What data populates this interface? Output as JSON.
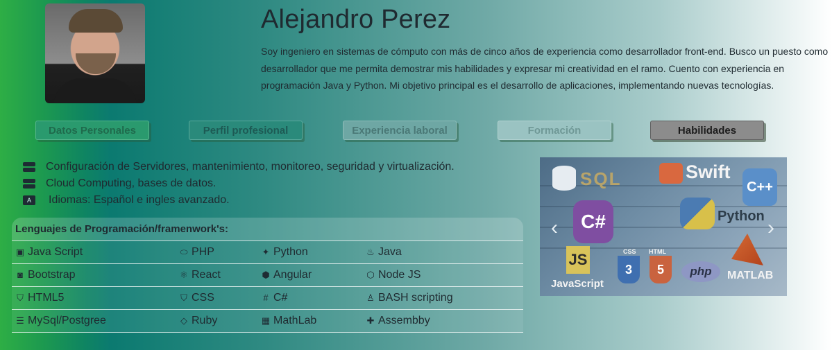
{
  "profile": {
    "name": "Alejandro Perez",
    "bio": "Soy ingeniero en sistemas de cómputo con más de cinco años de experiencia como desarrollador front-end. Busco un puesto como desarrollador que me permita demostrar mis habilidades y expresar mi creatividad en el ramo. Cuento con experiencia en programación Java y Python. Mi objetivo principal es el desarrollo de aplicaciones, implementando nuevas tecnologías."
  },
  "tabs": [
    {
      "label": "Datos Personales"
    },
    {
      "label": "Perfil profesional"
    },
    {
      "label": "Experiencia laboral"
    },
    {
      "label": "Formación"
    },
    {
      "label": "Habilidades",
      "active": true
    }
  ],
  "skills": [
    {
      "icon": "server-icon",
      "text": "Configuración de Servidores, mantenimiento, monitoreo, seguridad y virtualización."
    },
    {
      "icon": "server-icon",
      "text": "Cloud Computing, bases de datos."
    },
    {
      "icon": "language-icon",
      "text": "Idiomas: Español e ingles avanzado."
    }
  ],
  "languages_table": {
    "header": "Lenguajes de Programación/framenwork's:",
    "rows": [
      [
        {
          "icon": "js-icon",
          "label": "Java Script"
        },
        {
          "icon": "php-icon",
          "label": "PHP"
        },
        {
          "icon": "python-icon",
          "label": "Python"
        },
        {
          "icon": "java-icon",
          "label": "Java"
        }
      ],
      [
        {
          "icon": "bootstrap-icon",
          "label": "Bootstrap"
        },
        {
          "icon": "react-icon",
          "label": "React"
        },
        {
          "icon": "angular-icon",
          "label": "Angular"
        },
        {
          "icon": "node-icon",
          "label": "Node JS"
        }
      ],
      [
        {
          "icon": "html5-icon",
          "label": "HTML5"
        },
        {
          "icon": "css-icon",
          "label": "CSS"
        },
        {
          "icon": "hashtag-icon",
          "label": "C#"
        },
        {
          "icon": "linux-icon",
          "label": "BASH scripting"
        }
      ],
      [
        {
          "icon": "database-icon",
          "label": "MySql/Postgree"
        },
        {
          "icon": "gem-icon",
          "label": "Ruby"
        },
        {
          "icon": "calculator-icon",
          "label": "MathLab"
        },
        {
          "icon": "puzzle-icon",
          "label": "Assembby"
        }
      ]
    ]
  },
  "carousel": {
    "logos": {
      "sql": "SQL",
      "swift": "Swift",
      "cpp": "C++",
      "csharp": "C#",
      "python": "Python",
      "js": "JS",
      "javascript": "JavaScript",
      "css": "CSS",
      "html": "HTML",
      "php": "php",
      "matlab": "MATLAB"
    },
    "prev": "‹",
    "next": "›"
  },
  "colors": {
    "active_tab": "#8c8c8c",
    "text": "#1f2a30"
  }
}
